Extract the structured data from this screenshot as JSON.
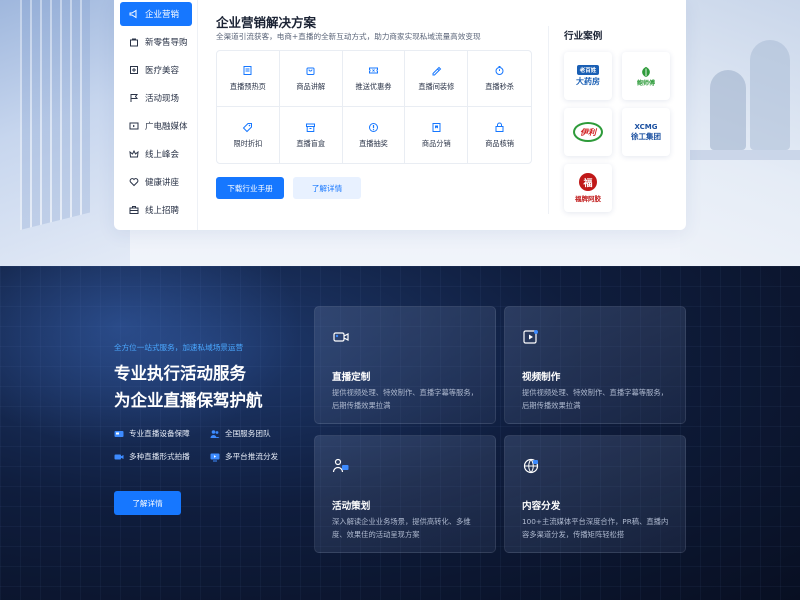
{
  "sidebar": {
    "items": [
      {
        "label": "企业营销",
        "icon": "megaphone-icon",
        "active": true
      },
      {
        "label": "新零售导购",
        "icon": "bag-icon"
      },
      {
        "label": "医疗美容",
        "icon": "clinic-icon"
      },
      {
        "label": "活动现场",
        "icon": "flag-icon"
      },
      {
        "label": "广电融媒体",
        "icon": "media-icon"
      },
      {
        "label": "线上峰会",
        "icon": "crown-icon"
      },
      {
        "label": "健康讲座",
        "icon": "heart-icon"
      },
      {
        "label": "线上招聘",
        "icon": "briefcase-icon"
      }
    ]
  },
  "solution": {
    "title": "企业营销解决方案",
    "desc": "全渠道引流获客，电商+直播的全新互动方式，助力商家实现私域流量高效变现",
    "features": [
      {
        "label": "直播预热页",
        "icon": "page-icon"
      },
      {
        "label": "商品讲解",
        "icon": "cart-icon"
      },
      {
        "label": "推送优惠券",
        "icon": "coupon-icon"
      },
      {
        "label": "直播间装修",
        "icon": "brush-icon"
      },
      {
        "label": "直播秒杀",
        "icon": "timer-icon"
      },
      {
        "label": "限时折扣",
        "icon": "tag-icon"
      },
      {
        "label": "直播盲盒",
        "icon": "box-icon"
      },
      {
        "label": "直播抽奖",
        "icon": "lottery-icon"
      },
      {
        "label": "商品分销",
        "icon": "share-icon"
      },
      {
        "label": "商品核销",
        "icon": "lock-icon"
      }
    ],
    "download_label": "下载行业手册",
    "detail_label": "了解详情"
  },
  "cases": {
    "title": "行业案例",
    "logos": [
      {
        "name": "老百姓大药房",
        "text": "大药房",
        "badge": "老百姓",
        "color": "#1a5fb4"
      },
      {
        "name": "鲍师傅",
        "text": "鲍师傅",
        "color": "#2e9b3a"
      },
      {
        "name": "伊利",
        "text": "伊利",
        "color": "#d02020"
      },
      {
        "name": "徐工集团",
        "text": "徐工集团",
        "badge": "XCMG",
        "color": "#1a4fa0"
      },
      {
        "name": "福牌阿胶",
        "text": "福牌阿胶",
        "color": "#c01818"
      }
    ]
  },
  "service": {
    "subtitle": "全方位一站式服务，加速私域场景运营",
    "title_line1": "专业执行活动服务",
    "title_line2": "为企业直播保驾护航",
    "features": [
      {
        "label": "专业直播设备保障",
        "icon": "device-icon"
      },
      {
        "label": "全国服务团队",
        "icon": "team-icon"
      },
      {
        "label": "多种直播形式拍播",
        "icon": "camera-icon"
      },
      {
        "label": "多平台推流分发",
        "icon": "broadcast-icon"
      }
    ],
    "button_label": "了解详情",
    "cards": [
      {
        "title": "直播定制",
        "desc": "提供视频处理、特效制作、直播字幕等服务，后期传播效果拉满",
        "icon": "live-camera-icon"
      },
      {
        "title": "视频制作",
        "desc": "提供视频处理、特效制作、直播字幕等服务，后期传播效果拉满",
        "icon": "video-edit-icon"
      },
      {
        "title": "活动策划",
        "desc": "深入解读企业业务场景，提供高转化、多维度、效果佳的活动呈现方案",
        "icon": "planner-icon"
      },
      {
        "title": "内容分发",
        "desc": "100+主流媒体平台深度合作，PR稿、直播内容多渠道分发，传播矩阵轻松搭",
        "icon": "globe-icon"
      }
    ]
  },
  "colors": {
    "accent": "#1677ff",
    "accent_light": "#e8f1ff",
    "sub_blue": "#4aa8ff",
    "dark_bg": "#0b1428"
  }
}
